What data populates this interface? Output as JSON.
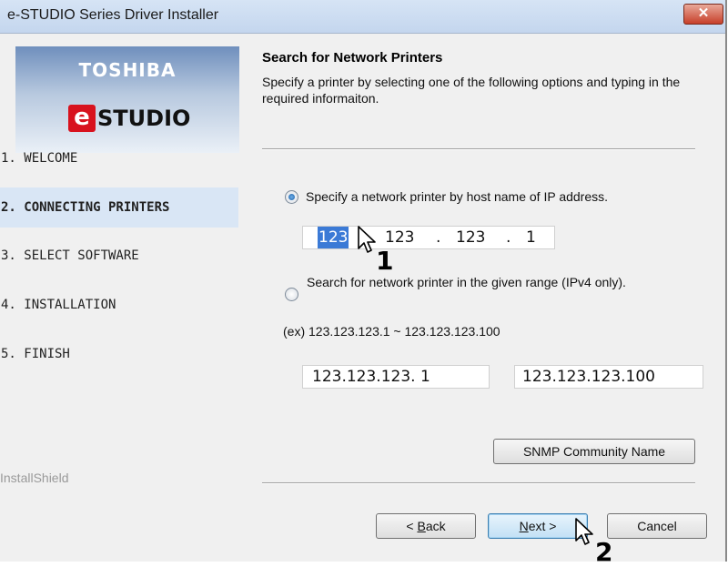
{
  "window": {
    "title": "e-STUDIO Series Driver Installer",
    "close_symbol": "✕"
  },
  "logo": {
    "brand": "TOSHIBA",
    "product_e": "e",
    "product_rest": "STUDIO"
  },
  "sidebar": {
    "steps": [
      {
        "label": "1. WELCOME",
        "active": false
      },
      {
        "label": "2. CONNECTING PRINTERS",
        "active": true
      },
      {
        "label": "3. SELECT SOFTWARE",
        "active": false
      },
      {
        "label": "4. INSTALLATION",
        "active": false
      },
      {
        "label": "5. FINISH",
        "active": false
      }
    ],
    "footer": "InstallShield"
  },
  "main": {
    "heading": "Search for Network Printers",
    "description": "Specify a printer by selecting one of the following options and typing in the required informaiton.",
    "option_host": {
      "label": "Specify a network printer by host name of IP address.",
      "selected": true,
      "ip_segments": [
        "123",
        ".",
        "123",
        ".",
        "123",
        ".",
        "1"
      ]
    },
    "option_range": {
      "label": "Search for network printer in the given range (IPv4 only).",
      "selected": false,
      "example": "(ex) 123.123.123.1 ~ 123.123.123.100",
      "start_ip": "123.123.123. 1",
      "end_ip": "123.123.123.100"
    },
    "snmp_button": "SNMP Community Name"
  },
  "footer_buttons": {
    "back": "< Back",
    "back_mnemonic": "B",
    "next": "Next >",
    "next_mnemonic": "N",
    "cancel": "Cancel"
  },
  "callouts": {
    "one": "1",
    "two": "2"
  },
  "colors": {
    "selection": "#3b7ad6",
    "active_step_bg": "#d9e6f5",
    "close_button": "#c7402a",
    "logo_e": "#d8121e"
  }
}
